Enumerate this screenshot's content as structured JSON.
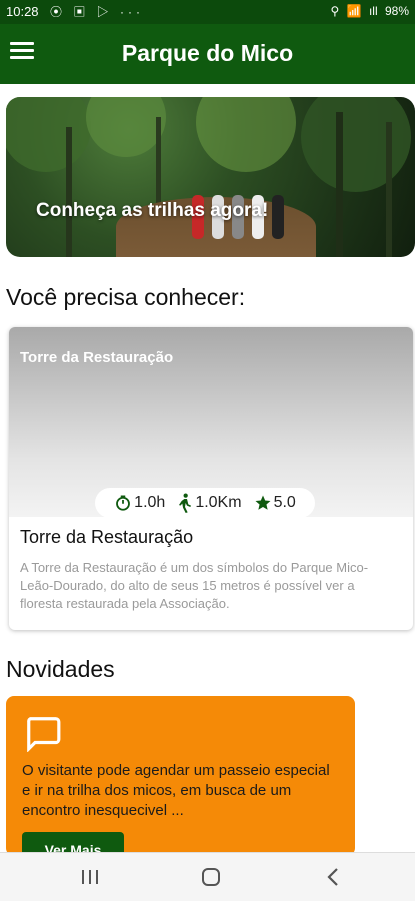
{
  "status_bar": {
    "time": "10:28",
    "left_icons": "⦿ ▣ ▷ ···",
    "right_icons": [
      "⚲",
      "📶",
      "ıll"
    ],
    "battery": "98%"
  },
  "app_bar": {
    "title": "Parque do Mico",
    "menu_icon": "hamburger-icon"
  },
  "hero": {
    "caption": "Conheça as trilhas agora!"
  },
  "sections": {
    "conhecer_title": "Você precisa conhecer:",
    "novidades_title": "Novidades"
  },
  "featured": {
    "image_title": "Torre da Restauração",
    "duration": "1.0h",
    "distance": "1.0Km",
    "rating": "5.0",
    "name": "Torre da Restauração",
    "description": "A Torre da Restauração é um dos símbolos do Parque Mico-Leão-Dourado, do alto de seus 15 metros é possível ver a floresta restaurada pela Associação."
  },
  "news": {
    "text": "O visitante pode agendar um passeio especial e ir na trilha dos micos, em busca de um encontro inesquecivel ...",
    "button": "Ver Mais",
    "icon": "chat-icon"
  },
  "colors": {
    "primary": "#0f5a0f",
    "status": "#0c4a0c",
    "accent": "#f58a07"
  }
}
